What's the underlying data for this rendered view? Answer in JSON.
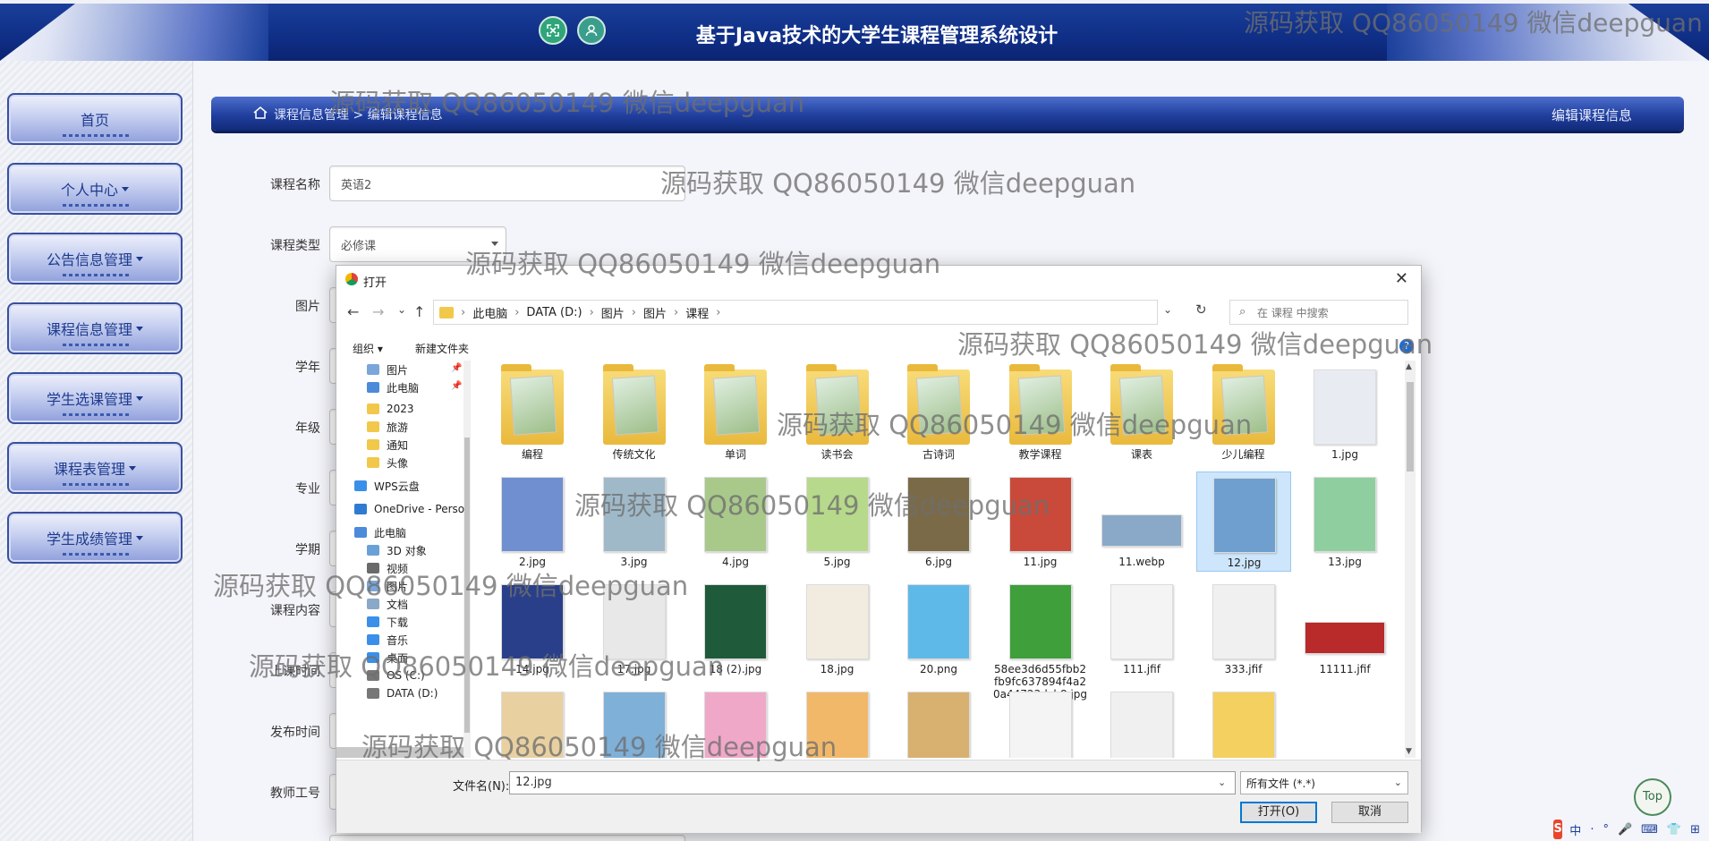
{
  "header": {
    "title": "基于Java技术的大学生课程管理系统设计",
    "icons": [
      "fullscreen-icon",
      "user-icon"
    ]
  },
  "sidebar": {
    "items": [
      {
        "label": "首页",
        "has_caret": false
      },
      {
        "label": "个人中心",
        "has_caret": true
      },
      {
        "label": "公告信息管理",
        "has_caret": true
      },
      {
        "label": "课程信息管理",
        "has_caret": true
      },
      {
        "label": "学生选课管理",
        "has_caret": true
      },
      {
        "label": "课程表管理",
        "has_caret": true
      },
      {
        "label": "学生成绩管理",
        "has_caret": true
      }
    ]
  },
  "breadcrumb": {
    "path": "课程信息管理 > 编辑课程信息",
    "page_heading": "编辑课程信息"
  },
  "form": {
    "course_name_label": "课程名称",
    "course_name_value": "英语2",
    "course_type_label": "课程类型",
    "course_type_value": "必修课",
    "labels": [
      "图片",
      "学年",
      "年级",
      "专业",
      "学期",
      "课程内容",
      "上课时间",
      "发布时间",
      "教师工号"
    ]
  },
  "dialog": {
    "title": "打开",
    "close": "✕",
    "nav": {
      "back": "←",
      "forward": "→",
      "recent": "⌄",
      "up": "↑"
    },
    "address": [
      "此电脑",
      "DATA (D:)",
      "图片",
      "图片",
      "课程"
    ],
    "search_placeholder": "在 课程 中搜索",
    "toolbar": {
      "organize": "组织 ▾",
      "new_folder": "新建文件夹"
    },
    "nav_pane": [
      {
        "label": "图片",
        "icon": "#7aa6d9",
        "pinned": true
      },
      {
        "label": "此电脑",
        "icon": "#4b8bd9",
        "pinned": true
      },
      {
        "label": "2023",
        "icon": "#f2c84b",
        "pinned": false
      },
      {
        "label": "旅游",
        "icon": "#f2c84b",
        "pinned": false
      },
      {
        "label": "通知",
        "icon": "#f2c84b",
        "pinned": false
      },
      {
        "label": "头像",
        "icon": "#f2c84b",
        "pinned": false
      },
      {
        "label": "WPS云盘",
        "icon": "#3a8fe8",
        "pinned": false
      },
      {
        "label": "OneDrive - Perso",
        "icon": "#2f7bd1",
        "pinned": false
      },
      {
        "label": "此电脑",
        "icon": "#4b8bd9",
        "pinned": false
      },
      {
        "label": "3D 对象",
        "icon": "#6aa0d8",
        "pinned": false
      },
      {
        "label": "视频",
        "icon": "#6a6a6a",
        "pinned": false
      },
      {
        "label": "图片",
        "icon": "#7aa6d9",
        "pinned": false
      },
      {
        "label": "文档",
        "icon": "#8aa8c8",
        "pinned": false
      },
      {
        "label": "下载",
        "icon": "#3a8fe8",
        "pinned": false
      },
      {
        "label": "音乐",
        "icon": "#3a8fe8",
        "pinned": false
      },
      {
        "label": "桌面",
        "icon": "#3a8fe8",
        "pinned": false
      },
      {
        "label": "OS (C:)",
        "icon": "#777777",
        "pinned": false
      },
      {
        "label": "DATA (D:)",
        "icon": "#777777",
        "pinned": false
      }
    ],
    "files": [
      {
        "name": "编程",
        "kind": "folder",
        "color": "#c9d8b0"
      },
      {
        "name": "传统文化",
        "kind": "folder",
        "color": "#e8d3a3"
      },
      {
        "name": "单词",
        "kind": "folder",
        "color": "#9fb98b"
      },
      {
        "name": "读书会",
        "kind": "folder",
        "color": "#bcd7a8"
      },
      {
        "name": "古诗词",
        "kind": "folder",
        "color": "#d8c8a8"
      },
      {
        "name": "教学课程",
        "kind": "folder",
        "color": "#d8d0b8"
      },
      {
        "name": "课表",
        "kind": "folder",
        "color": "#dfe6e0"
      },
      {
        "name": "少儿编程",
        "kind": "folder",
        "color": "#c0d8e8"
      },
      {
        "name": "1.jpg",
        "kind": "image",
        "color": "#e8ecf2"
      },
      {
        "name": "2.jpg",
        "kind": "image",
        "color": "#6f8fd0"
      },
      {
        "name": "3.jpg",
        "kind": "image",
        "color": "#9fb9c9"
      },
      {
        "name": "4.jpg",
        "kind": "image",
        "color": "#a9c98b"
      },
      {
        "name": "5.jpg",
        "kind": "image",
        "color": "#b7d98b"
      },
      {
        "name": "6.jpg",
        "kind": "image",
        "color": "#7a6a48"
      },
      {
        "name": "11.jpg",
        "kind": "image",
        "color": "#c94a3a"
      },
      {
        "name": "11.webp",
        "kind": "wide",
        "color": "#8aa9c8"
      },
      {
        "name": "12.jpg",
        "kind": "image",
        "color": "#6f9fcf",
        "selected": true
      },
      {
        "name": "13.jpg",
        "kind": "image",
        "color": "#8fcf9f"
      },
      {
        "name": "14.jpg",
        "kind": "image",
        "color": "#2a3f8a"
      },
      {
        "name": "17.jpg",
        "kind": "image",
        "color": "#e8e8e8"
      },
      {
        "name": "18 (2).jpg",
        "kind": "image",
        "color": "#1f5a3a"
      },
      {
        "name": "18.jpg",
        "kind": "image",
        "color": "#f2ece0"
      },
      {
        "name": "20.png",
        "kind": "image",
        "color": "#5fb9e8"
      },
      {
        "name": "58ee3d6d55fbb2fb9fc637894f4a20a44723dcb8.jpg",
        "kind": "image",
        "color": "#3f9f3a"
      },
      {
        "name": "111.jfif",
        "kind": "image",
        "color": "#f4f4f4"
      },
      {
        "name": "333.jfif",
        "kind": "image",
        "color": "#f0f0f0"
      },
      {
        "name": "11111.jfif",
        "kind": "wide",
        "color": "#b92a2a"
      },
      {
        "name": "",
        "kind": "image",
        "color": "#e8d0a0"
      },
      {
        "name": "",
        "kind": "image",
        "color": "#7fb0d8"
      },
      {
        "name": "",
        "kind": "image",
        "color": "#f0a8c8"
      },
      {
        "name": "",
        "kind": "image",
        "color": "#f2b86a"
      },
      {
        "name": "",
        "kind": "image",
        "color": "#d8b070"
      },
      {
        "name": "",
        "kind": "image",
        "color": "#f4f4f4"
      },
      {
        "name": "",
        "kind": "image",
        "color": "#f0f0f0"
      },
      {
        "name": "",
        "kind": "image",
        "color": "#f4d060"
      }
    ],
    "filename_label": "文件名(N):",
    "filename_value": "12.jpg",
    "filetype_value": "所有文件 (*.*)",
    "open_button": "打开(O)",
    "cancel_button": "取消"
  },
  "watermark_text": "源码获取 QQ86050149 微信deepguan",
  "top_button": "Top",
  "ime": {
    "logo": "S",
    "items": [
      "中",
      "·",
      "°",
      "🎤",
      "⌨",
      "👕",
      "⊞"
    ]
  }
}
